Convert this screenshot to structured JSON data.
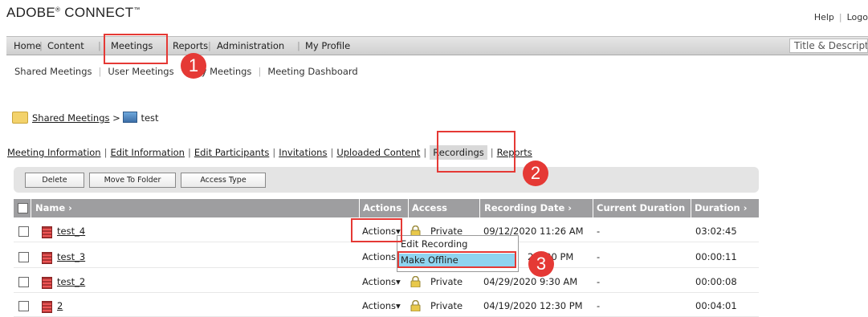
{
  "header": {
    "logo": "ADOBE",
    "logo_mark": "®",
    "logo_product": " CONNECT",
    "logo_tm": "™",
    "help": "Help",
    "logout": "Logo"
  },
  "main_nav": {
    "items": [
      "Home",
      "Content",
      "Meetings",
      "Reports",
      "Administration",
      "My Profile"
    ],
    "search_placeholder": "Title & Descripti"
  },
  "sub_nav": {
    "items": [
      "Shared Meetings",
      "User Meetings",
      "My Meetings",
      "Meeting Dashboard"
    ],
    "user_meetings_visible": "User Meetings",
    "my_meetings_visible": "y Meetings"
  },
  "breadcrumb": {
    "parent": "Shared Meetings",
    "separator": ">",
    "current": "test"
  },
  "tabs": [
    "Meeting Information",
    "Edit Information",
    "Edit Participants",
    "Invitations",
    "Uploaded Content",
    "Recordings",
    "Reports"
  ],
  "toolbar": {
    "delete": "Delete",
    "move": "Move To Folder",
    "access": "Access Type"
  },
  "table": {
    "headers": {
      "name": "Name",
      "actions": "Actions",
      "access": "Access",
      "date": "Recording Date",
      "current": "Current Duration",
      "duration": "Duration"
    },
    "rows": [
      {
        "name": "test_4",
        "actions": "Actions",
        "access": "Private",
        "date": "09/12/2020 11:26 AM",
        "current": "-",
        "duration": "03:02:45"
      },
      {
        "name": "test_3",
        "actions": "Actions",
        "access": "",
        "date": "20  :00 PM",
        "current": "-",
        "duration": "00:00:11"
      },
      {
        "name": "test_2",
        "actions": "Actions",
        "access": "Private",
        "date": "04/29/2020 9:30 AM",
        "current": "-",
        "duration": "00:00:08"
      },
      {
        "name": "2",
        "actions": "Actions",
        "access": "Private",
        "date": "04/19/2020 12:30 PM",
        "current": "-",
        "duration": "00:04:01"
      }
    ]
  },
  "menu": {
    "items": [
      "Edit Recording",
      "Make Offline"
    ]
  },
  "callouts": [
    "1",
    "2",
    "3"
  ],
  "colors": {
    "callout": "#e53935",
    "highlight": "#8fd4f0",
    "table_header": "#9e9ea0"
  }
}
